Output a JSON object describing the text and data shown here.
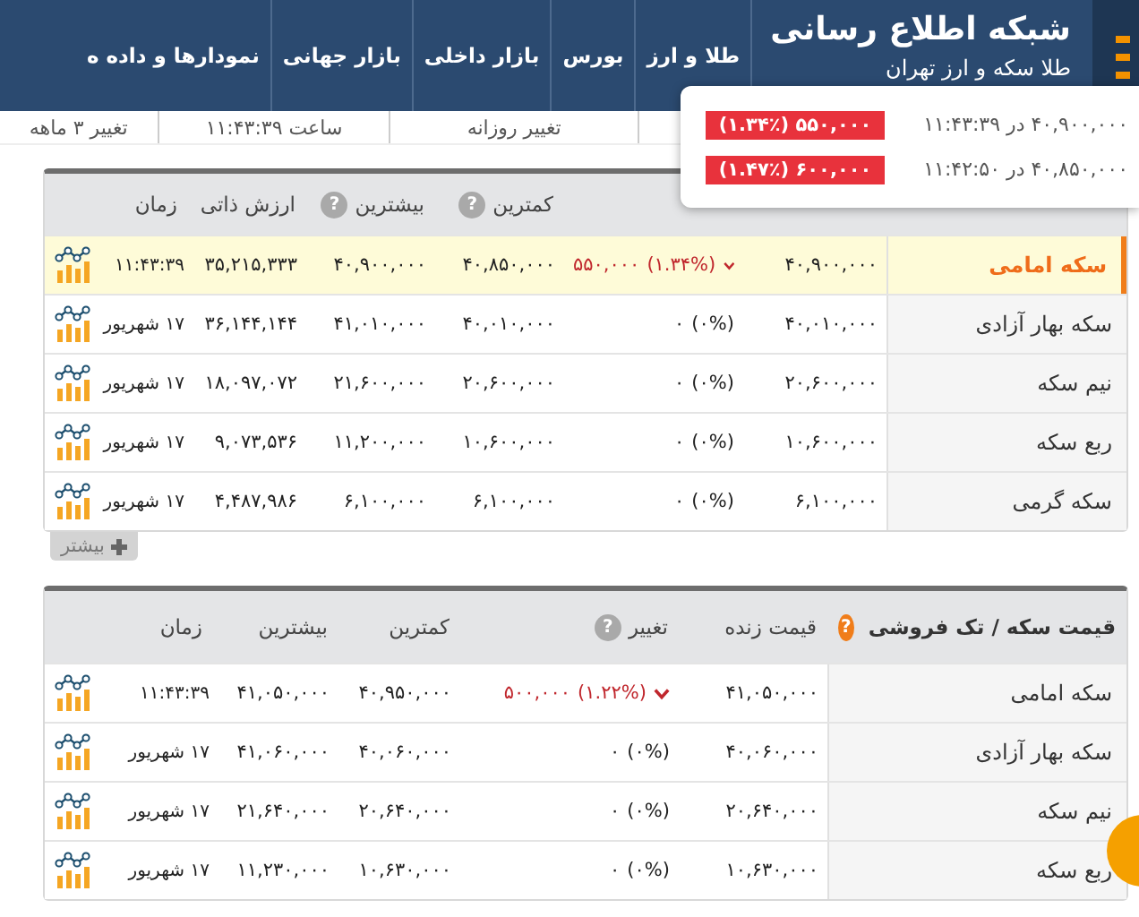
{
  "site": {
    "title": "شبکه اطلاع رسانی",
    "subtitle": "طلا سکه و ارز تهران"
  },
  "nav": [
    {
      "label": "طلا و ارز"
    },
    {
      "label": "بورس"
    },
    {
      "label": "بازار داخلی"
    },
    {
      "label": "بازار جهانی"
    },
    {
      "label": "نمودارها و داده ه"
    }
  ],
  "info_strip": [
    {
      "label": "تغییر روزانه"
    },
    {
      "label": "ساعت ۱۱:۴۳:۳۹"
    },
    {
      "label": "تغییر ۳ ماهه"
    }
  ],
  "popup": [
    {
      "text": "۴۰,۹۰۰,۰۰۰ در ۱۱:۴۳:۳۹",
      "badge": "۵۵۰,۰۰۰ (۱.۳۴٪)"
    },
    {
      "text": "۴۰,۸۵۰,۰۰۰ در ۱۱:۴۲:۵۰",
      "badge": "۶۰۰,۰۰۰ (۱.۴۷٪)"
    }
  ],
  "table_1": {
    "columns": [
      {
        "label": "کمترین",
        "help": "?"
      },
      {
        "label": "بیشترین",
        "help": "?"
      },
      {
        "label": "ارزش ذاتی"
      },
      {
        "label": "زمان"
      }
    ],
    "rows": [
      {
        "name": "سکه امامی",
        "selected": true,
        "price": "۴۰,۹۰۰,۰۰۰",
        "falling": true,
        "percent": "(۱.۳۴%)",
        "change": "۵۵۰,۰۰۰",
        "min": "۴۰,۸۵۰,۰۰۰",
        "max": "۴۰,۹۰۰,۰۰۰",
        "intrinsic": "۳۵,۲۱۵,۳۳۳",
        "time": "۱۱:۴۳:۳۹"
      },
      {
        "name": "سکه بهار آزادی",
        "selected": false,
        "price": "۴۰,۰۱۰,۰۰۰",
        "falling": false,
        "percent": "(۰%)",
        "change": "۰",
        "min": "۴۰,۰۱۰,۰۰۰",
        "max": "۴۱,۰۱۰,۰۰۰",
        "intrinsic": "۳۶,۱۴۴,۱۴۴",
        "time": "۱۷ شهریور"
      },
      {
        "name": "نیم سکه",
        "selected": false,
        "price": "۲۰,۶۰۰,۰۰۰",
        "falling": false,
        "percent": "(۰%)",
        "change": "۰",
        "min": "۲۰,۶۰۰,۰۰۰",
        "max": "۲۱,۶۰۰,۰۰۰",
        "intrinsic": "۱۸,۰۹۷,۰۷۲",
        "time": "۱۷ شهریور"
      },
      {
        "name": "ربع سکه",
        "selected": false,
        "price": "۱۰,۶۰۰,۰۰۰",
        "falling": false,
        "percent": "(۰%)",
        "change": "۰",
        "min": "۱۰,۶۰۰,۰۰۰",
        "max": "۱۱,۲۰۰,۰۰۰",
        "intrinsic": "۹,۰۷۳,۵۳۶",
        "time": "۱۷ شهریور"
      },
      {
        "name": "سکه گرمی",
        "selected": false,
        "price": "۶,۱۰۰,۰۰۰",
        "falling": false,
        "percent": "(۰%)",
        "change": "۰",
        "min": "۶,۱۰۰,۰۰۰",
        "max": "۶,۱۰۰,۰۰۰",
        "intrinsic": "۴,۴۸۷,۹۸۶",
        "time": "۱۷ شهریور"
      }
    ],
    "more_button": "بیشتر"
  },
  "table_2": {
    "title": "قیمت سکه / تک فروشی",
    "title_help": "?",
    "columns": [
      {
        "label": "قیمت زنده"
      },
      {
        "label": "تغییر",
        "help": "?"
      },
      {
        "label": "کمترین"
      },
      {
        "label": "بیشترین"
      },
      {
        "label": "زمان"
      }
    ],
    "rows": [
      {
        "name": "سکه امامی",
        "selected": false,
        "price": "۴۱,۰۵۰,۰۰۰",
        "falling": true,
        "percent": "(۱.۲۲%)",
        "change": "۵۰۰,۰۰۰",
        "min": "۴۰,۹۵۰,۰۰۰",
        "max": "۴۱,۰۵۰,۰۰۰",
        "time": "۱۱:۴۳:۳۹"
      },
      {
        "name": "سکه بهار آزادی",
        "selected": false,
        "price": "۴۰,۰۶۰,۰۰۰",
        "falling": false,
        "percent": "(۰%)",
        "change": "۰",
        "min": "۴۰,۰۶۰,۰۰۰",
        "max": "۴۱,۰۶۰,۰۰۰",
        "time": "۱۷ شهریور"
      },
      {
        "name": "نیم سکه",
        "selected": false,
        "price": "۲۰,۶۴۰,۰۰۰",
        "falling": false,
        "percent": "(۰%)",
        "change": "۰",
        "min": "۲۰,۶۴۰,۰۰۰",
        "max": "۲۱,۶۴۰,۰۰۰",
        "time": "۱۷ شهریور"
      },
      {
        "name": "ربع سکه",
        "selected": false,
        "price": "۱۰,۶۳۰,۰۰۰",
        "falling": false,
        "percent": "(۰%)",
        "change": "۰",
        "min": "۱۰,۶۳۰,۰۰۰",
        "max": "۱۱,۲۳۰,۰۰۰",
        "time": "۱۷ شهریور"
      }
    ]
  }
}
